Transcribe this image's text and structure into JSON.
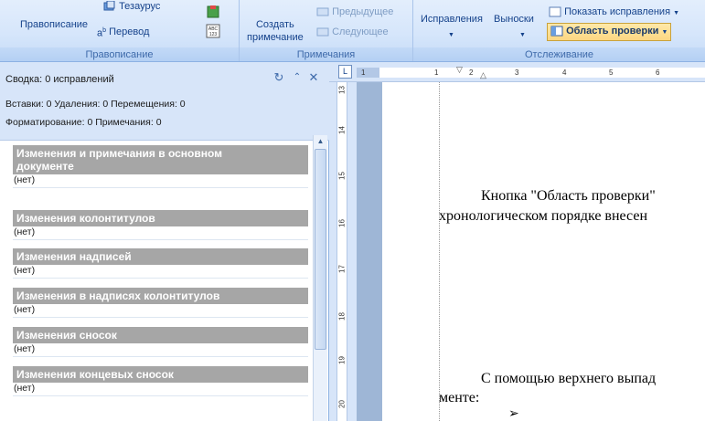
{
  "ribbon": {
    "spelling_group": {
      "spelling_label": "Правописание",
      "thesaurus_label": "Тезаурус",
      "translate_label": "Перевод",
      "group_label": "Правописание"
    },
    "comments_group": {
      "create_comment_line1": "Создать",
      "create_comment_line2": "примечание",
      "previous_label": "Предыдущее",
      "next_label": "Следующее",
      "group_label": "Примечания"
    },
    "tracking_group": {
      "track_changes_label": "Исправления",
      "balloons_label": "Выноски",
      "show_markup_label": "Показать исправления",
      "reviewing_pane_label": "Область проверки",
      "group_label": "Отслеживание"
    }
  },
  "pane": {
    "title": "Сводка: 0 исправлений",
    "stats_line1": "Вставки: 0  Удаления: 0  Перемещения: 0",
    "stats_line2": "Форматирование: 0  Примечания: 0",
    "sections": [
      {
        "title_line1": "Изменения и примечания в основном",
        "title_line2": "документе",
        "none": "(нет)"
      },
      {
        "title": "Изменения колонтитулов",
        "none": "(нет)"
      },
      {
        "title": "Изменения надписей",
        "none": "(нет)"
      },
      {
        "title": "Изменения в надписях колонтитулов",
        "none": "(нет)"
      },
      {
        "title": "Изменения сносок",
        "none": "(нет)"
      },
      {
        "title": "Изменения концевых сносок",
        "none": "(нет)"
      }
    ]
  },
  "ruler": {
    "h_ticks": [
      "1",
      "1",
      "2",
      "3",
      "4",
      "5",
      "6"
    ],
    "v_ticks": [
      "13",
      "14",
      "15",
      "16",
      "17",
      "18",
      "19",
      "20"
    ]
  },
  "document": {
    "line1": "Кнопка \"Область проверки\"",
    "line2": "хронологическом порядке внесен",
    "line3": "С помощью верхнего выпад",
    "line4": "менте:"
  },
  "colors": {
    "ribbon_bg": "#d6e6fb",
    "section_header": "#a6a6a6",
    "highlight_button": "#fcd782",
    "page_bg": "#ffffff"
  }
}
